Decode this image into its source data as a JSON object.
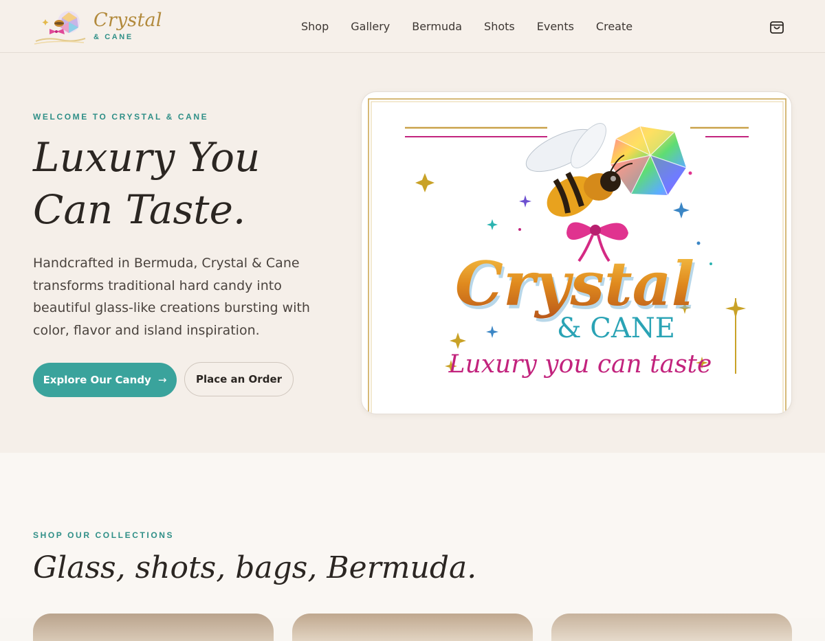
{
  "header": {
    "brand_name": "Crystal",
    "brand_sub": "& CANE",
    "nav": [
      "Shop",
      "Gallery",
      "Bermuda",
      "Shots",
      "Events",
      "Create"
    ],
    "cart_icon": "shopping-bag-icon"
  },
  "hero": {
    "eyebrow": "WELCOME TO CRYSTAL & CANE",
    "title_line1": "Luxury You",
    "title_line2": "Can Taste.",
    "description": "Handcrafted in Bermuda, Crystal & Cane transforms traditional hard candy into beautiful glass-like creations bursting with color, flavor and island inspiration.",
    "primary_button": "Explore Our Candy",
    "primary_button_icon": "arrow-right-icon",
    "secondary_button": "Place an Order",
    "logo_text_main": "Crystal",
    "logo_text_sub": "& CANE",
    "logo_tagline": "Luxury you can taste"
  },
  "collections": {
    "eyebrow": "SHOP OUR COLLECTIONS",
    "title": "Glass, shots, bags, Bermuda."
  },
  "colors": {
    "accent_teal": "#3aa39c",
    "gold": "#b28a3c",
    "magenta": "#c2237d",
    "hero_bg": "#f5efe9",
    "page_bg": "#faf7f3"
  }
}
